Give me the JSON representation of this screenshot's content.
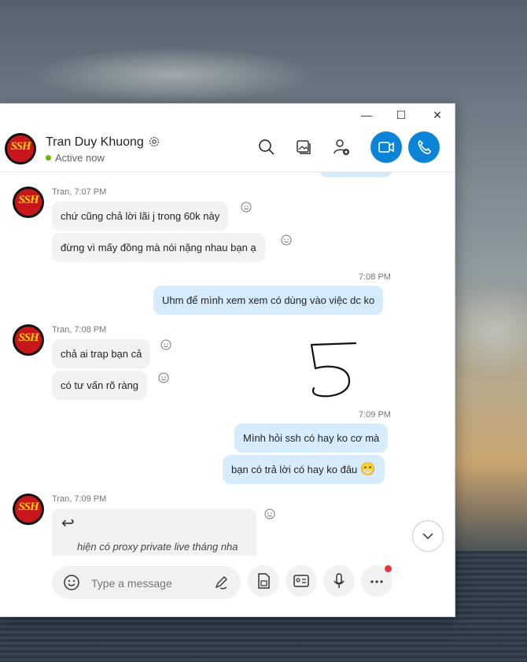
{
  "window": {
    "minimize_glyph": "—",
    "maximize_glyph": "☐",
    "close_glyph": "✕"
  },
  "contact": {
    "name": "Tran Duy Khuong",
    "status": "Active now",
    "avatar_text": "SSH"
  },
  "header_icons": [
    "search-icon",
    "gallery-icon",
    "add-person-icon",
    "video-call-icon",
    "audio-call-icon"
  ],
  "messages": {
    "g1_meta": "Tran, 7:07 PM",
    "g1_m1": "chứ cũng chả lời lãi j trong 60k này",
    "g1_m2": "đừng vì mấy đồng mà nói nặng nhau bạn ạ",
    "o1_time": "7:08 PM",
    "o1_m1": "Uhm để mình xem xem có dùng vào việc dc ko",
    "g2_meta": "Tran, 7:08 PM",
    "g2_m1": "chả ai trap bạn cả",
    "g2_m2": "có tư vấn rõ ràng",
    "o2_time": "7:09 PM",
    "o2_m1": "Mình hỏi ssh có hay ko cơ mà",
    "o2_m2": "bạn có trả lời có hay ko đâu",
    "o2_m2_emoji": "😁",
    "g3_meta": "Tran, 7:09 PM",
    "g3_m1_quote": "hiện có proxy private live tháng nha",
    "reply_glyph": "↩"
  },
  "composer": {
    "placeholder": "Type a message"
  },
  "colors": {
    "accent": "#0a84d6",
    "outgoing_bubble": "#d6ebfb",
    "incoming_bubble": "#f1f2f4",
    "online": "#6bb700",
    "notification": "#e8333b"
  }
}
